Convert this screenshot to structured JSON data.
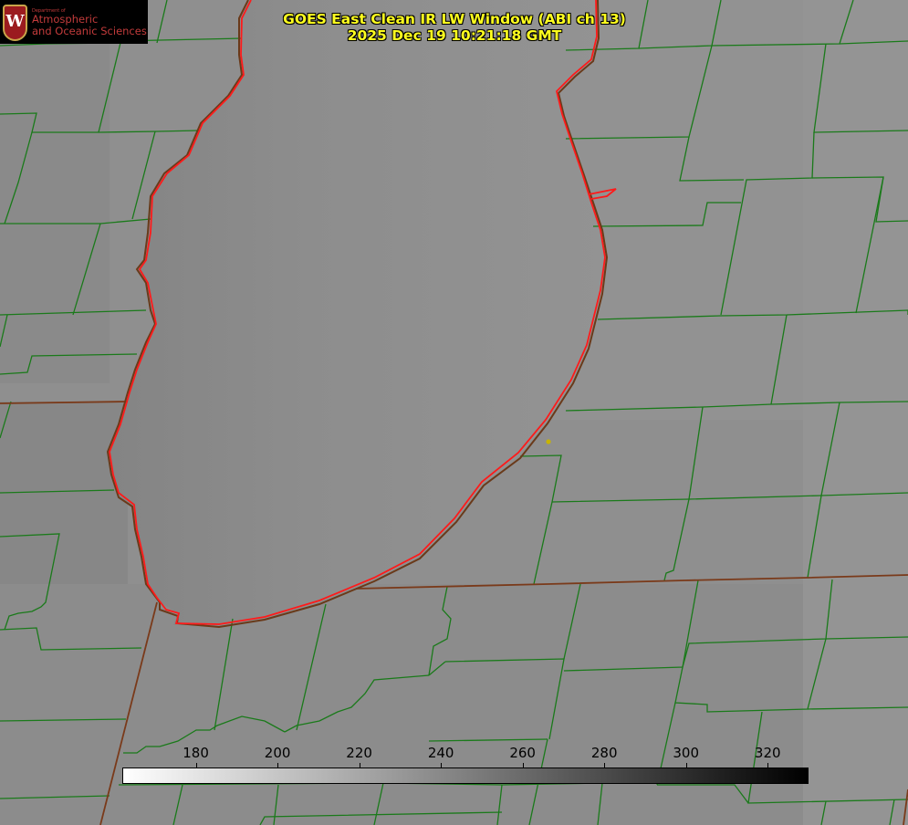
{
  "title": {
    "line1": "GOES East Clean IR LW Window (ABI ch 13)",
    "line2": "2025 Dec 19 10:21:18 GMT"
  },
  "logo": {
    "crest_letter": "W",
    "department": "Department of",
    "name_line1": "Atmospheric",
    "name_line2": "and Oceanic Sciences"
  },
  "colorbar": {
    "tick_labels": [
      "180",
      "200",
      "220",
      "240",
      "260",
      "280",
      "300",
      "320"
    ],
    "min_value": 162,
    "max_value": 330,
    "gradient": [
      "#ffffff",
      "#000000"
    ]
  },
  "colors": {
    "background": "#8e8e8e",
    "county_lines": "#1a7a1a",
    "state_lines": "#7a3a1a",
    "lake_shore": "#ff0000",
    "text": "#ffff1f",
    "marker": "#c8b400"
  },
  "map": {
    "feature": "lake-michigan-south"
  }
}
